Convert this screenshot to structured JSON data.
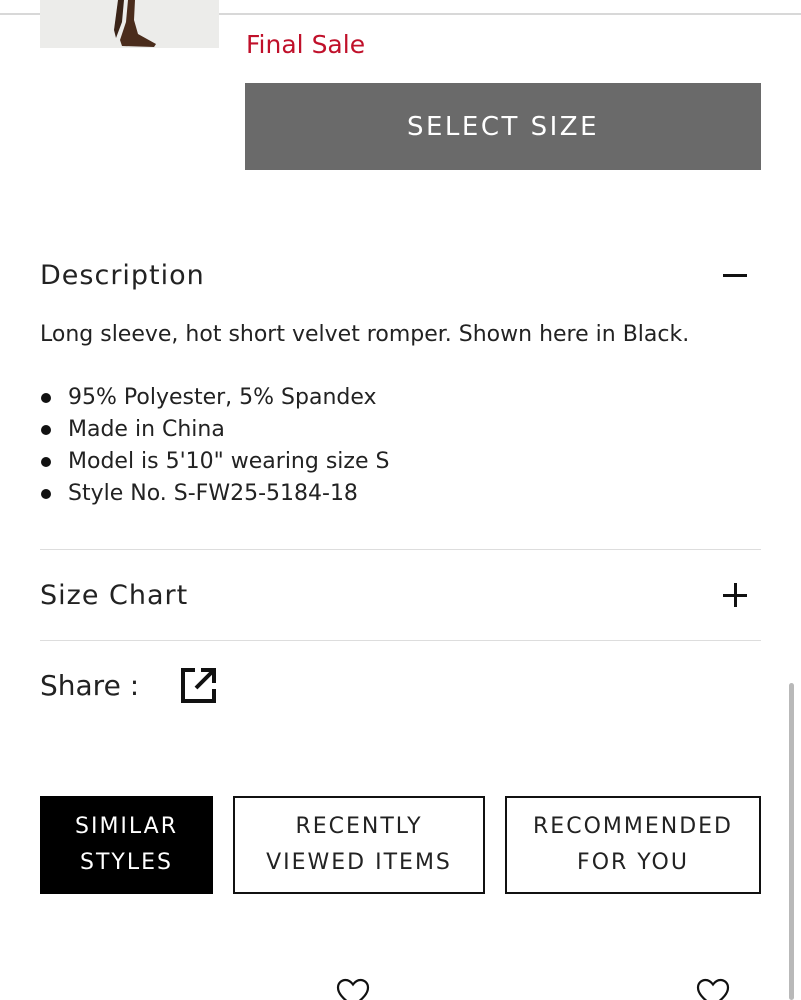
{
  "product": {
    "sale_label": "Final Sale",
    "select_size_label": "SELECT SIZE"
  },
  "description": {
    "title": "Description",
    "toggle_state": "expanded",
    "text": "Long sleeve, hot short velvet romper. Shown here in Black.",
    "bullets": [
      "95% Polyester, 5% Spandex",
      "Made in China",
      "Model is 5'10\" wearing size S",
      "Style No. S-FW25-5184-18"
    ]
  },
  "size_chart": {
    "title": "Size Chart",
    "toggle_state": "collapsed"
  },
  "share": {
    "label": "Share :",
    "icon": "share-external-icon"
  },
  "tabs": [
    {
      "line1": "SIMILAR",
      "line2": "STYLES",
      "active": true
    },
    {
      "line1": "RECENTLY",
      "line2": "VIEWED ITEMS",
      "active": false
    },
    {
      "line1": "RECOMMENDED",
      "line2": "FOR YOU",
      "active": false
    }
  ],
  "colors": {
    "sale_red": "#c0102a",
    "select_button_bg": "#6a6a6a",
    "active_tab_bg": "#000000"
  },
  "icons": [
    "minus-icon",
    "plus-icon",
    "share-external-icon",
    "heart-icon"
  ]
}
